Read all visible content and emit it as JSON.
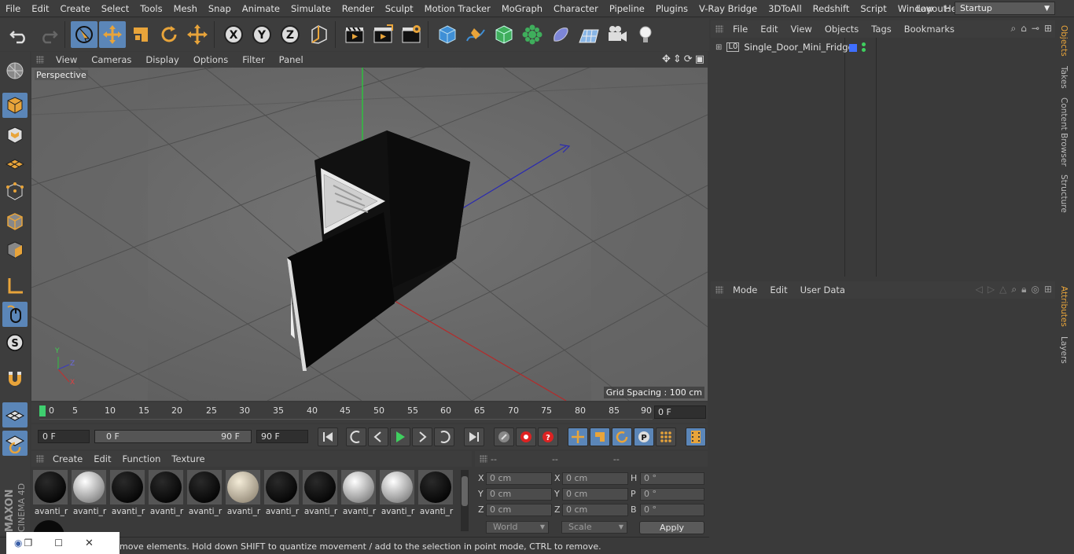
{
  "menubar": {
    "items": [
      "File",
      "Edit",
      "Create",
      "Select",
      "Tools",
      "Mesh",
      "Snap",
      "Animate",
      "Simulate",
      "Render",
      "Sculpt",
      "Motion Tracker",
      "MoGraph",
      "Character",
      "Pipeline",
      "Plugins",
      "V-Ray Bridge",
      "3DToAll",
      "Redshift",
      "Script",
      "Window",
      "Help"
    ],
    "layout_label": "Layout:",
    "layout_value": "Startup"
  },
  "viewport": {
    "menu": [
      "View",
      "Cameras",
      "Display",
      "Options",
      "Filter",
      "Panel"
    ],
    "label": "Perspective",
    "grid_spacing": "Grid Spacing : 100 cm",
    "axes": {
      "y": "Y",
      "z": "Z",
      "x": "X"
    }
  },
  "timeline": {
    "ticks": [
      "0",
      "5",
      "10",
      "15",
      "20",
      "25",
      "30",
      "35",
      "40",
      "45",
      "50",
      "55",
      "60",
      "65",
      "70",
      "75",
      "80",
      "85",
      "90"
    ],
    "current_frame": "0 F"
  },
  "transport": {
    "start_field": "0 F",
    "range_start": "0 F",
    "range_end": "90 F",
    "end_field": "90 F"
  },
  "materials": {
    "menu": [
      "Create",
      "Edit",
      "Function",
      "Texture"
    ],
    "items": [
      {
        "name": "avanti_r",
        "shade": "black"
      },
      {
        "name": "avanti_r",
        "shade": "white"
      },
      {
        "name": "avanti_r",
        "shade": "black"
      },
      {
        "name": "avanti_r",
        "shade": "black"
      },
      {
        "name": "avanti_r",
        "shade": "black"
      },
      {
        "name": "avanti_r",
        "shade": "cream"
      },
      {
        "name": "avanti_r",
        "shade": "black"
      },
      {
        "name": "avanti_r",
        "shade": "black"
      },
      {
        "name": "avanti_r",
        "shade": "white"
      },
      {
        "name": "avanti_r",
        "shade": "white"
      },
      {
        "name": "avanti_r",
        "shade": "black"
      }
    ]
  },
  "coordinates": {
    "headers": [
      "--",
      "--",
      "--"
    ],
    "rows": [
      {
        "l1": "X",
        "v1": "0 cm",
        "l2": "X",
        "v2": "0 cm",
        "l3": "H",
        "v3": "0 °"
      },
      {
        "l1": "Y",
        "v1": "0 cm",
        "l2": "Y",
        "v2": "0 cm",
        "l3": "P",
        "v3": "0 °"
      },
      {
        "l1": "Z",
        "v1": "0 cm",
        "l2": "Z",
        "v2": "0 cm",
        "l3": "B",
        "v3": "0 °"
      }
    ],
    "world": "World",
    "scale": "Scale",
    "apply": "Apply"
  },
  "objects": {
    "menu": [
      "File",
      "Edit",
      "View",
      "Objects",
      "Tags",
      "Bookmarks"
    ],
    "tree": [
      {
        "name": "Single_Door_Mini_Fridge"
      }
    ]
  },
  "attributes": {
    "menu": [
      "Mode",
      "Edit",
      "User Data"
    ]
  },
  "sidetabs": {
    "top": [
      "Objects",
      "Takes",
      "Content Browser",
      "Structure"
    ],
    "bottom": [
      "Attributes",
      "Layers"
    ]
  },
  "status": {
    "text": "move elements. Hold down SHIFT to quantize movement / add to the selection in point mode, CTRL to remove."
  },
  "branding": {
    "maxon": "MAXON",
    "cinema": "CINEMA 4D"
  },
  "colors": {
    "accent": "#e8a43a",
    "active_blue": "#5b86b8",
    "bg": "#3a3a3a"
  }
}
